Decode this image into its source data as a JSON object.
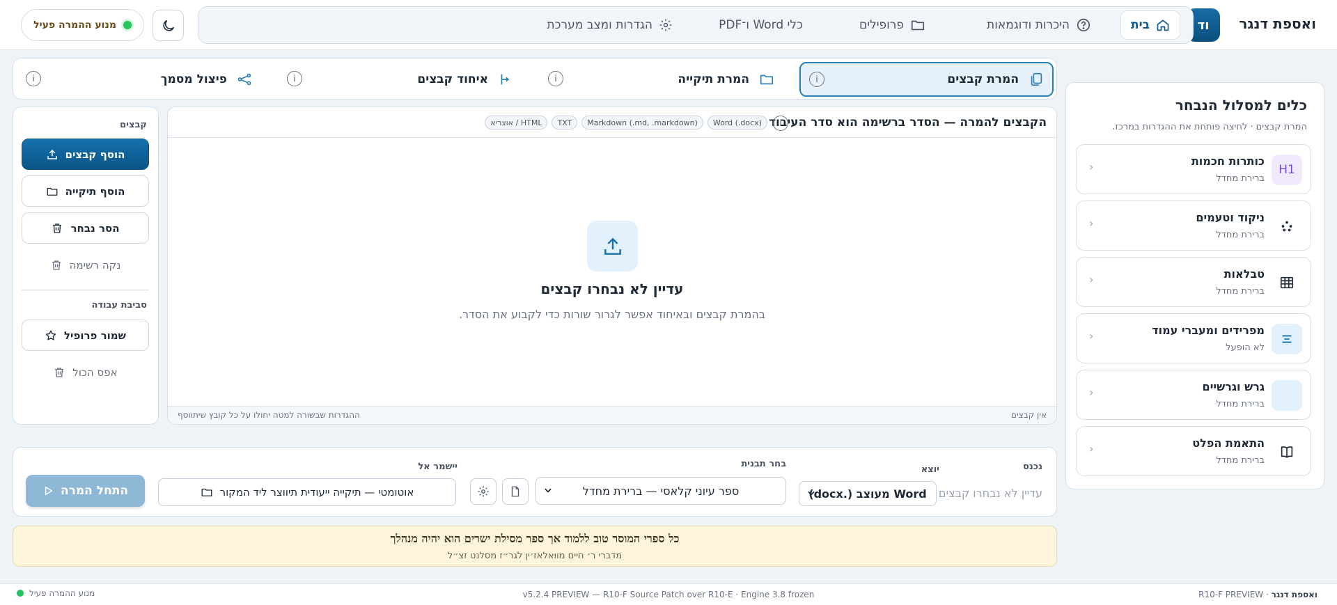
{
  "header": {
    "brand": "ואספת דנגר",
    "logo_text": "וד",
    "nav": [
      {
        "label": "בית",
        "icon": "home-icon",
        "active": true
      },
      {
        "label": "היכרות ודוגמאות",
        "icon": "help-icon"
      },
      {
        "label": "פרופילים",
        "icon": "folder-icon"
      },
      {
        "label": "כלי Word ו־PDF",
        "icon": ""
      },
      {
        "label": "הגדרות ומצב מערכת",
        "icon": "gear-icon"
      }
    ],
    "engine_status": "מנוע ההמרה פעיל"
  },
  "modes": [
    {
      "label": "המרת קבצים",
      "icon": "copy-icon",
      "active": true
    },
    {
      "label": "המרת תיקייה",
      "icon": "folder-icon"
    },
    {
      "label": "איחוד קבצים",
      "icon": "merge-icon"
    },
    {
      "label": "פיצול מסמך",
      "icon": "split-icon"
    }
  ],
  "tools": {
    "title": "כלים למסלול הנבחר",
    "subtitle": "המרת קבצים · לחיצה פותחת את ההגדרות במרכז.",
    "items": [
      {
        "name": "כותרות חכמות",
        "state": "ברירת מחדל",
        "icon_text": "H1"
      },
      {
        "name": "ניקוד וטעמים",
        "state": "ברירת מחדל"
      },
      {
        "name": "טבלאות",
        "state": "ברירת מחדל"
      },
      {
        "name": "מפרידים ומעברי עמוד",
        "state": "לא הופעל"
      },
      {
        "name": "גרש וגרשיים",
        "state": "ברירת מחדל"
      },
      {
        "name": "התאמת הפלט",
        "state": "ברירת מחדל"
      }
    ]
  },
  "actions": {
    "files_heading": "קבצים",
    "add_files": "הוסף קבצים",
    "add_folder": "הוסף תיקייה",
    "remove_selected": "הסר נבחר",
    "clear_list": "נקה רשימה",
    "workspace_heading": "סביבת עבודה",
    "save_profile": "שמור פרופיל",
    "reset_all": "אפס הכול"
  },
  "files": {
    "title": "הקבצים להמרה — הסדר ברשימה הוא סדר העיבוד",
    "formats": [
      "Word (.docx)",
      "Markdown (.md, .markdown)",
      "TXT",
      "HTML / אוצריא"
    ],
    "empty_title": "עדיין לא נבחרו קבצים",
    "empty_sub": "בהמרת קבצים ובאיחוד אפשר לגרור שורות כדי לקבוע את הסדר.",
    "footer_count": "אין קבצים",
    "footer_note": "ההגדרות שבשורה למטה יחולו על כל קובץ שיתווסף"
  },
  "controls": {
    "input_label": "נכנס",
    "input_placeholder": "עדיין לא נבחרו קבצים",
    "output_label": "יוצא",
    "output_value": "Word מעוצב (.docx)",
    "template_label": "בחר תבנית",
    "template_value": "ספר עיוני קלאסי — ברירת מחדל",
    "save_to_label": "יישמר אל",
    "save_to_value": "אוטומטי — תיקייה ייעודית תיווצר ליד המקור",
    "start_label": "התחל המרה"
  },
  "quote": {
    "text": "כל ספרי המוסר טוב ללמוד אך ספר מסילת ישרים הוא יהיה מנהלך",
    "source": "מדברי ר׳ חיים מוואלאז׳ין לגר״ז מסלנט זצ״ל"
  },
  "statusbar": {
    "brand": "ואספת דנגר",
    "build": "R10-F PREVIEW",
    "version": "v5.2.4 PREVIEW — R10-F Source Patch over R10-E · Engine 3.8 frozen",
    "engine": "מנוע ההמרה פעיל"
  },
  "colors": {
    "primary": "#0c5587",
    "accent": "#2a7fb8",
    "background": "#eef3f8",
    "engine_ok": "#22c55e",
    "quote_bg": "#fdf4dc"
  }
}
